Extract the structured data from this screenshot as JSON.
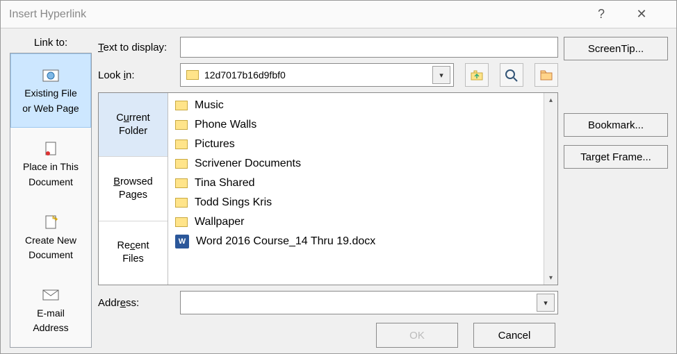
{
  "titlebar": {
    "title": "Insert Hyperlink",
    "help": "?",
    "close": "✕"
  },
  "left": {
    "label": "Link to:",
    "items": [
      {
        "line1": "Existing File",
        "line2": "or Web Page"
      },
      {
        "line1": "Place in This",
        "line2": "Document"
      },
      {
        "line1": "Create New",
        "line2": "Document"
      },
      {
        "line1": "E-mail",
        "line2": "Address"
      }
    ]
  },
  "center": {
    "text_to_display_label": "Text to display:",
    "text_to_display_value": "",
    "look_in_label": "Look in:",
    "look_in_value": "12d7017b16d9fbf0",
    "address_label": "Address:",
    "address_value": "",
    "browse_tabs": [
      {
        "line1": "Current",
        "line2": "Folder"
      },
      {
        "line1": "Browsed",
        "line2": "Pages"
      },
      {
        "line1": "Recent",
        "line2": "Files"
      }
    ],
    "files": [
      {
        "type": "folder",
        "name": "Music"
      },
      {
        "type": "folder",
        "name": "Phone Walls"
      },
      {
        "type": "folder",
        "name": "Pictures"
      },
      {
        "type": "folder",
        "name": "Scrivener Documents"
      },
      {
        "type": "folder",
        "name": "Tina Shared"
      },
      {
        "type": "folder",
        "name": "Todd Sings Kris"
      },
      {
        "type": "folder",
        "name": "Wallpaper"
      },
      {
        "type": "docx",
        "name": "Word 2016 Course_14 Thru 19.docx"
      }
    ]
  },
  "right": {
    "screentip": "ScreenTip...",
    "bookmark": "Bookmark...",
    "target_frame": "Target Frame..."
  },
  "footer": {
    "ok": "OK",
    "cancel": "Cancel"
  }
}
